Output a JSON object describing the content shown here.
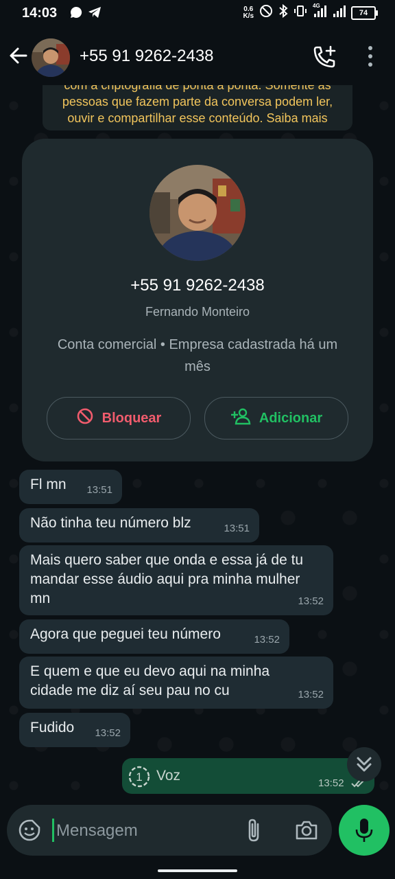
{
  "status_bar": {
    "time": "14:03",
    "speed_value": "0.6",
    "speed_unit": "K/s",
    "network_label": "4G",
    "battery": "74",
    "icons": [
      "whatsapp-icon",
      "telegram-icon",
      "do-not-disturb-icon",
      "bluetooth-icon",
      "vibrate-icon",
      "signal-icon",
      "signal-icon",
      "battery-icon"
    ]
  },
  "header": {
    "title": "+55 91 9262-2438",
    "icons": [
      "back-arrow-icon",
      "add-call-icon",
      "more-vert-icon"
    ]
  },
  "encryption_notice": {
    "lines": [
      "com a criptografia de ponta a ponta. Somente as",
      "pessoas que fazem parte da conversa podem ler,",
      "ouvir e compartilhar esse conteúdo. Saiba mais"
    ]
  },
  "contact_card": {
    "phone": "+55 91 9262-2438",
    "name": "Fernando Monteiro",
    "info": "Conta comercial • Empresa cadastrada há um mês",
    "block_label": "Bloquear",
    "add_label": "Adicionar"
  },
  "messages": [
    {
      "text": "Fl mn",
      "time": "13:51"
    },
    {
      "text": "Não tinha teu número blz",
      "time": "13:51"
    },
    {
      "text": "Mais quero saber que onda e essa já de tu mandar esse áudio aqui pra  minha mulher mn",
      "time": "13:52"
    },
    {
      "text": "Agora que peguei teu número",
      "time": "13:52"
    },
    {
      "text": "E quem e que eu devo aqui na minha cidade me diz aí seu pau no cu",
      "time": "13:52"
    },
    {
      "text": "Fudido",
      "time": "13:52"
    }
  ],
  "outgoing_voice": {
    "label": "Voz",
    "time": "13:52",
    "view_once": "1"
  },
  "composer": {
    "placeholder": "Mensagem"
  },
  "colors": {
    "accent": "#21c063",
    "danger": "#f15c6d",
    "notice_text": "#f2c55c",
    "bubble_in": "#1f2c33",
    "bubble_out": "#134d37"
  }
}
